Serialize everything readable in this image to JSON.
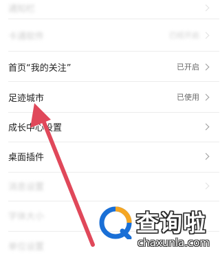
{
  "settings": {
    "rows": [
      {
        "label": "通知栏",
        "status": "",
        "blurred": true
      },
      {
        "label": "卡通软件",
        "status": "已经开启",
        "blurred": true
      },
      {
        "label": "首页“我的关注”",
        "status": "已开启",
        "blurred": false
      },
      {
        "label": "足迹城市",
        "status": "已使用",
        "blurred": false
      },
      {
        "label": "成长中心设置",
        "status": "",
        "blurred": false
      },
      {
        "label": "桌面插件",
        "status": "",
        "blurred": false
      },
      {
        "label": "消息设置",
        "status": "",
        "blurred": true
      },
      {
        "label": "字体大小",
        "status": "",
        "blurred": true
      },
      {
        "label": "单位设置",
        "status": "",
        "blurred": true
      }
    ]
  },
  "annotation": {
    "arrow_color": "#e0485a"
  },
  "watermark": {
    "title": "查询啦",
    "url": "chaxunla.com",
    "logo_colors": {
      "ring": "#1a6fd6",
      "ring_accent": "#f5a623",
      "inner": "#ffffff"
    }
  }
}
